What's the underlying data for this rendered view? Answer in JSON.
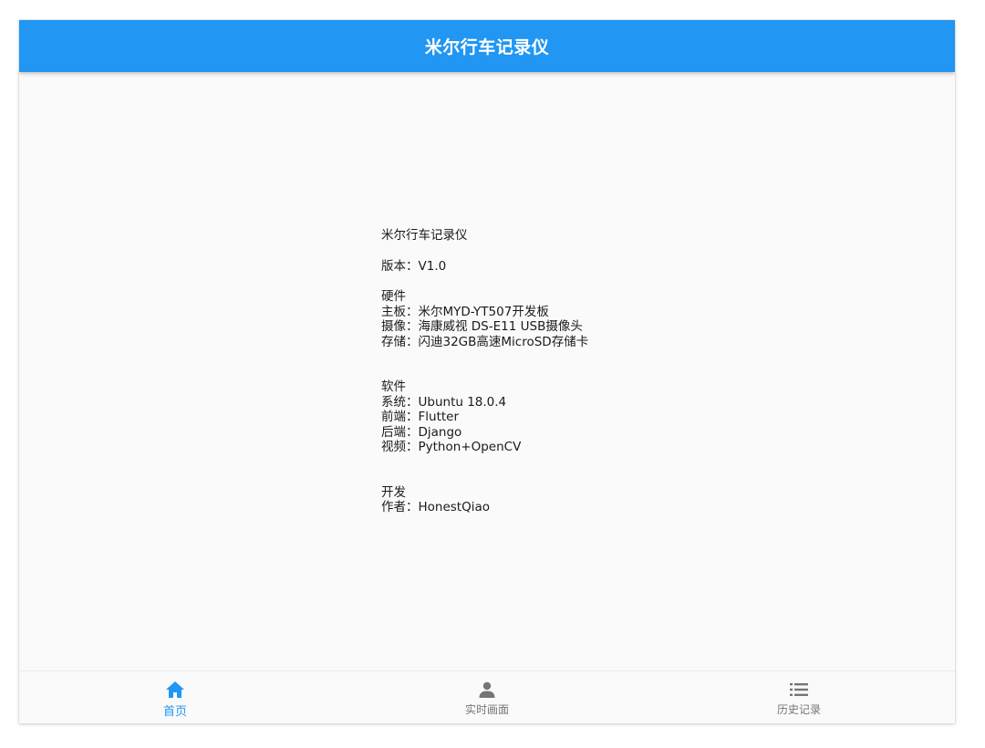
{
  "appbar": {
    "title": "米尔行车记录仪"
  },
  "info": {
    "name": "米尔行车记录仪",
    "version": "版本：V1.0",
    "hardware": {
      "heading": "硬件",
      "board": "主板：米尔MYD-YT507开发板",
      "camera": "摄像：海康威视 DS-E11 USB摄像头",
      "storage": "存储：闪迪32GB高速MicroSD存储卡"
    },
    "software": {
      "heading": "软件",
      "system": "系统：Ubuntu 18.0.4",
      "frontend": "前端：Flutter",
      "backend": "后端：Django",
      "video": "视频：Python+OpenCV"
    },
    "development": {
      "heading": "开发",
      "author": "作者：HonestQiao"
    }
  },
  "bottom_nav": {
    "active_index": 0,
    "items": [
      {
        "label": "首页",
        "icon": "home-icon"
      },
      {
        "label": "实时画面",
        "icon": "person-icon"
      },
      {
        "label": "历史记录",
        "icon": "list-icon"
      }
    ]
  },
  "colors": {
    "primary": "#2196f3",
    "inactive": "#757575",
    "background": "#fafafa"
  }
}
